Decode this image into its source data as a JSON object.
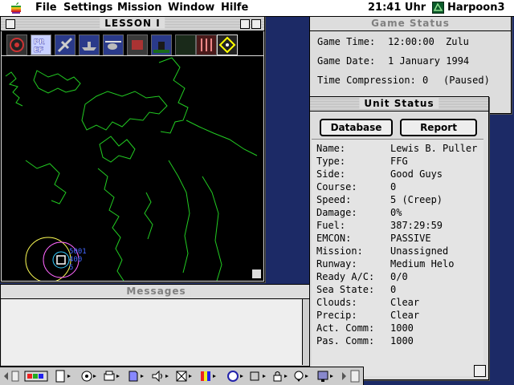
{
  "menubar": {
    "items": [
      "File",
      "Settings",
      "Mission",
      "Window",
      "Hilfe"
    ],
    "clock": "21:41 Uhr",
    "app_name": "Harpoon3"
  },
  "map_window": {
    "title": "LESSON I",
    "toolbar_buttons": [
      "compass-icon",
      "pref-icon",
      "aircraft-icon",
      "ship-icon",
      "helicopter-icon",
      "base-icon",
      "sub-icon",
      "missile-icon",
      "fuel-icon",
      "waypoint-icon"
    ],
    "unit_marker_labels": [
      "5001",
      "400",
      "5"
    ]
  },
  "game_status": {
    "title": "Game Status",
    "game_time_label": "Game Time:",
    "game_time_value": "12:00:00",
    "game_time_zone": "Zulu",
    "game_date_label": "Game Date:",
    "game_date_value": "1 January 1994",
    "time_compression_label": "Time Compression:",
    "time_compression_value": "0",
    "time_compression_state": "(Paused)"
  },
  "unit_status": {
    "title": "Unit Status",
    "database_button": "Database",
    "report_button": "Report",
    "fields": [
      {
        "label": "Name:",
        "value": "Lewis B. Puller"
      },
      {
        "label": "Type:",
        "value": "FFG"
      },
      {
        "label": "Side:",
        "value": "Good Guys"
      },
      {
        "label": "Course:",
        "value": "0"
      },
      {
        "label": "Speed:",
        "value": "5 (Creep)"
      },
      {
        "label": "Damage:",
        "value": "0%"
      },
      {
        "label": "Fuel:",
        "value": "387:29:59"
      },
      {
        "label": "EMCON:",
        "value": "PASSIVE"
      },
      {
        "label": "Mission:",
        "value": "Unassigned"
      },
      {
        "label": "Runway:",
        "value": "Medium Helo"
      },
      {
        "label": "Ready A/C:",
        "value": "0/0"
      },
      {
        "label": "Sea State:",
        "value": "0"
      },
      {
        "label": "Clouds:",
        "value": "Clear"
      },
      {
        "label": "Precip:",
        "value": "Clear"
      },
      {
        "label": "Act. Comm:",
        "value": "1000"
      },
      {
        "label": "Pas. Comm:",
        "value": "1000"
      }
    ]
  },
  "messages": {
    "title": "Messages"
  },
  "colors": {
    "desktop": "#1c2a66",
    "coastline": "#22cc22",
    "range_ring_outer": "#ffff55",
    "range_ring_inner": "#ff66ff",
    "unit_marker": "#33ccff"
  }
}
